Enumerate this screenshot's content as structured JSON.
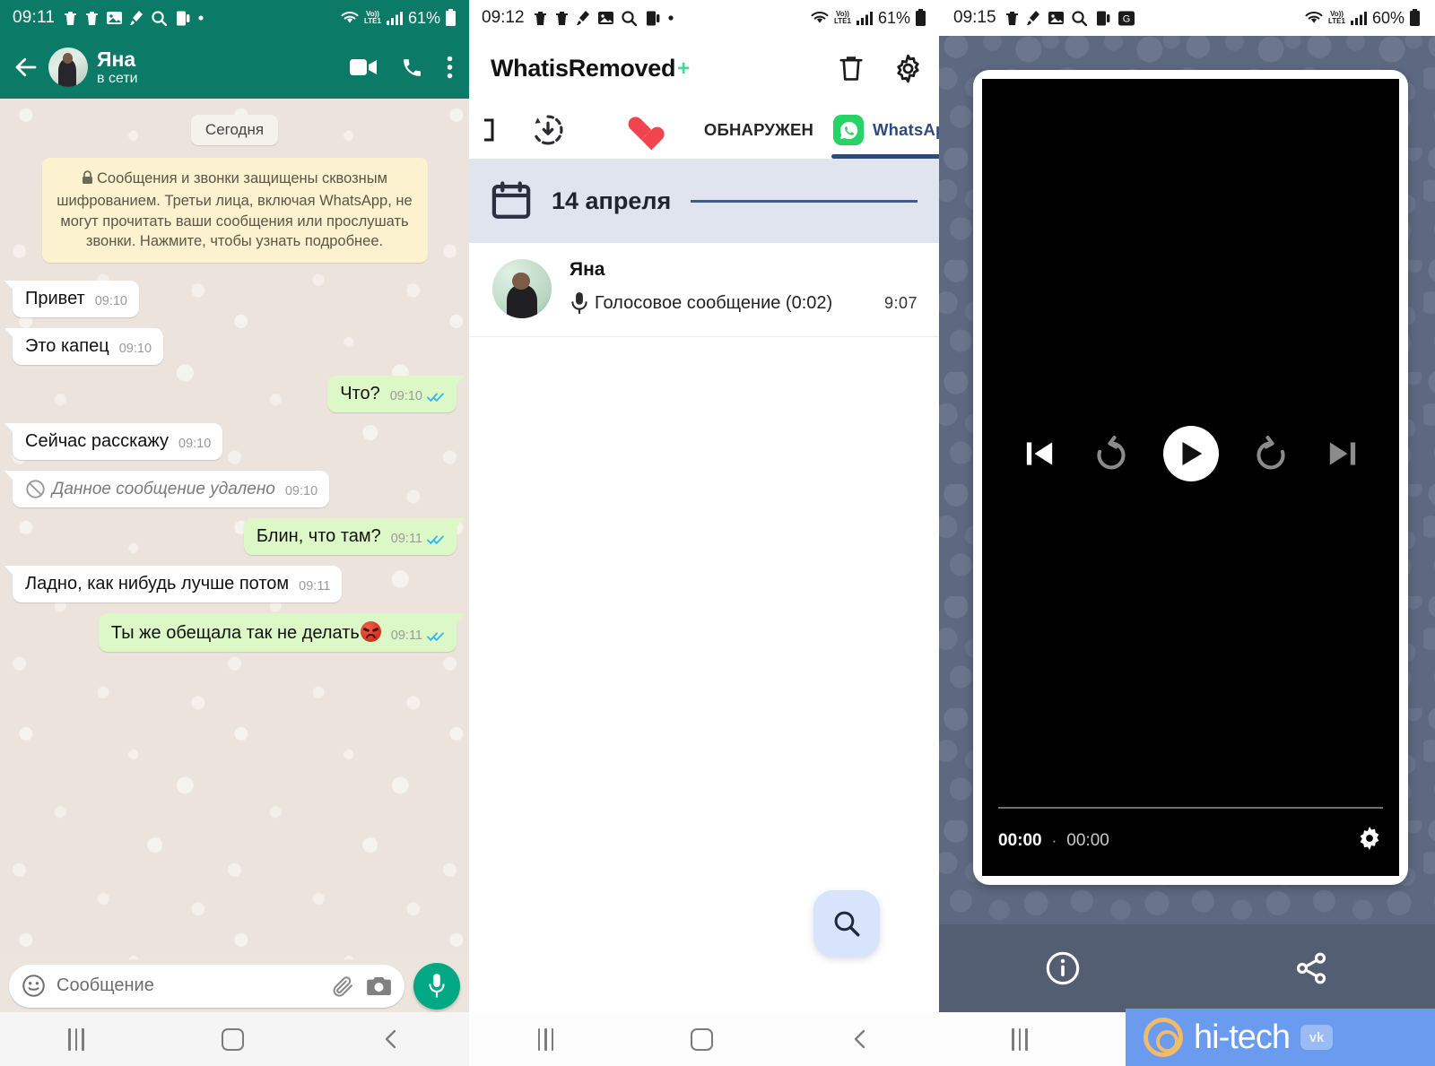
{
  "panel1": {
    "status_bar": {
      "time": "09:11",
      "battery": "61%",
      "network": "LTE1",
      "voice": "Vo))"
    },
    "header": {
      "contact_name": "Яна",
      "presence": "в сети"
    },
    "day_divider": "Сегодня",
    "encryption_notice": "Сообщения и звонки защищены сквозным шифрованием. Третьи лица, включая WhatsApp, не могут прочитать ваши сообщения или прослушать звонки. Нажмите, чтобы узнать подробнее.",
    "messages": [
      {
        "text": "Привет",
        "time": "09:10",
        "side": "in",
        "deleted": false
      },
      {
        "text": "Это капец",
        "time": "09:10",
        "side": "in",
        "deleted": false
      },
      {
        "text": "Что?",
        "time": "09:10",
        "side": "out",
        "deleted": false
      },
      {
        "text": "Сейчас расскажу",
        "time": "09:10",
        "side": "in",
        "deleted": false
      },
      {
        "text": "Данное сообщение удалено",
        "time": "09:10",
        "side": "in",
        "deleted": true
      },
      {
        "text": "Блин, что там?",
        "time": "09:11",
        "side": "out",
        "deleted": false
      },
      {
        "text": "Ладно, как нибудь лучше потом",
        "time": "09:11",
        "side": "in",
        "deleted": false
      },
      {
        "text": "Ты же обещала так не делать",
        "time": "09:11",
        "side": "out",
        "deleted": false,
        "emoji": "angry-face"
      }
    ],
    "input": {
      "placeholder": "Сообщение"
    }
  },
  "panel2": {
    "status_bar": {
      "time": "09:12",
      "battery": "61%",
      "network": "LTE1",
      "voice": "Vo))"
    },
    "app_title": "WhatisRemoved",
    "app_title_plus": "+",
    "tabs": [
      {
        "label": "",
        "icon": "restore-icon",
        "active": false
      },
      {
        "label": "",
        "icon": "heart-icon",
        "active": false
      },
      {
        "label": "ОБНАРУЖЕН",
        "icon": "",
        "active": false
      },
      {
        "label": "WhatsApp",
        "icon": "whatsapp-icon",
        "active": true
      }
    ],
    "date_header": "14 апреля",
    "entries": [
      {
        "name": "Яна",
        "text": "Голосовое сообщение (0:02)",
        "time": "9:07",
        "icon": "microphone-icon"
      }
    ]
  },
  "panel3": {
    "status_bar": {
      "time": "09:15",
      "battery": "60%",
      "network": "LTE1",
      "voice": "Vo))"
    },
    "player": {
      "current_time": "00:00",
      "separator": "·",
      "duration": "00:00",
      "controls": [
        "skip-previous",
        "replay-10",
        "play",
        "forward-10",
        "skip-next"
      ]
    },
    "bottom_actions": [
      "info-icon",
      "share-icon"
    ]
  },
  "watermark": {
    "text": "hi-tech",
    "vk": "vk"
  },
  "colors": {
    "whatsapp_green": "#0b7a66",
    "bubble_out": "#dcf8c6",
    "bubble_in": "#ffffff",
    "encryption_bg": "#fdf2d0",
    "tick_blue": "#34b7f1",
    "accent_blue": "#2e4a7d",
    "wa_badge": "#25d366",
    "player_bg": "#5d6881",
    "watermark_blue": "#6a9bee"
  }
}
